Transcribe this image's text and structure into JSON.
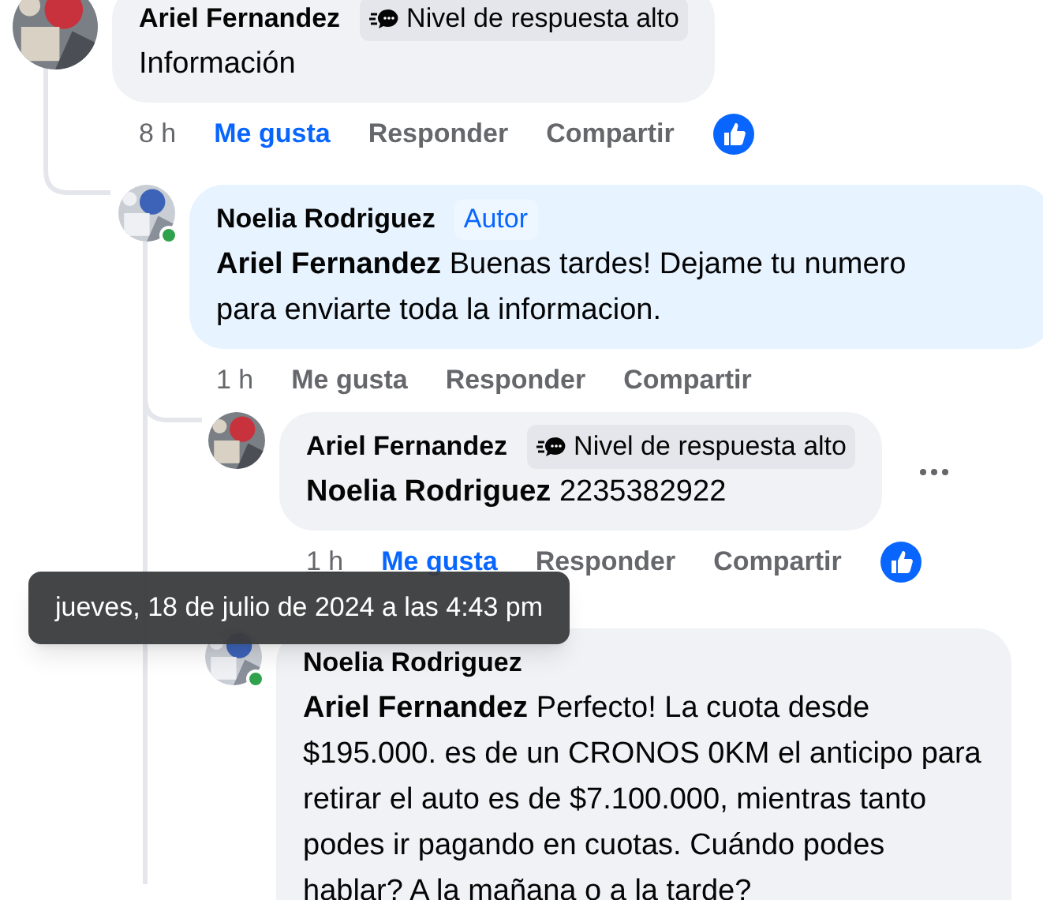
{
  "comments": [
    {
      "author": "Ariel Fernandez",
      "badge": {
        "kind": "top_fan",
        "label": "Nivel de respuesta alto"
      },
      "text": "Información",
      "time": "8 h",
      "liked": true,
      "actions": [
        "Me gusta",
        "Responder",
        "Compartir"
      ],
      "reaction": true
    },
    {
      "author": "Noelia Rodriguez",
      "badge": {
        "kind": "author",
        "label": "Autor"
      },
      "text": "**Ariel Fernandez** Buenas tardes! Dejame tu numero para enviarte toda la informacion.",
      "time": "1 h",
      "liked": false,
      "actions": [
        "Me gusta",
        "Responder",
        "Compartir"
      ],
      "online": true
    },
    {
      "author": "Ariel Fernandez",
      "badge": {
        "kind": "top_fan",
        "label": "Nivel de respuesta alto"
      },
      "text": "**Noelia Rodriguez** 2235382922",
      "time": "1 h",
      "liked": true,
      "actions": [
        "Me gusta",
        "Responder",
        "Compartir"
      ],
      "reaction": true,
      "more_button": true
    },
    {
      "author": "Noelia Rodriguez",
      "text": "**Ariel Fernandez** Perfecto! La cuota desde $195.000. es de un CRONOS 0KM el anticipo para retirar el auto es de $7.100.000, mientras tanto podes ir pagando en cuotas. Cuándo podes hablar? A la mañana o a la tarde?",
      "online": true
    }
  ],
  "tooltip": {
    "text": "jueves, 18 de julio de 2024 a las 4:43 pm"
  }
}
